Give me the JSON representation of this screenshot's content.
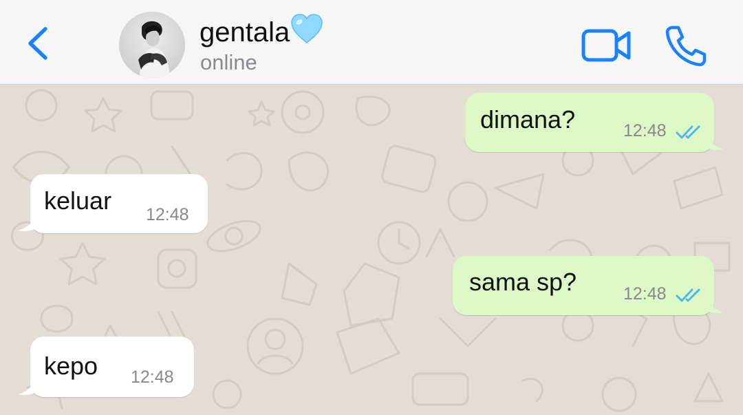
{
  "header": {
    "contact_name": "gentala",
    "name_emoji": "💙",
    "status": "online",
    "accent_color": "#1982fc"
  },
  "messages": [
    {
      "direction": "outgoing",
      "text": "dimana?",
      "time": "12:48",
      "read": true
    },
    {
      "direction": "incoming",
      "text": "keluar",
      "time": "12:48"
    },
    {
      "direction": "outgoing",
      "text": "sama sp?",
      "time": "12:48",
      "read": true
    },
    {
      "direction": "incoming",
      "text": "kepo",
      "time": "12:48"
    }
  ],
  "colors": {
    "outgoing_bubble": "#dcf8c6",
    "incoming_bubble": "#ffffff",
    "wallpaper": "#e4ddd5",
    "read_ticks": "#4fb6ec"
  },
  "icons": {
    "back": "chevron-left-icon",
    "video": "video-camera-icon",
    "phone": "phone-icon",
    "read_receipt": "double-check-icon"
  }
}
